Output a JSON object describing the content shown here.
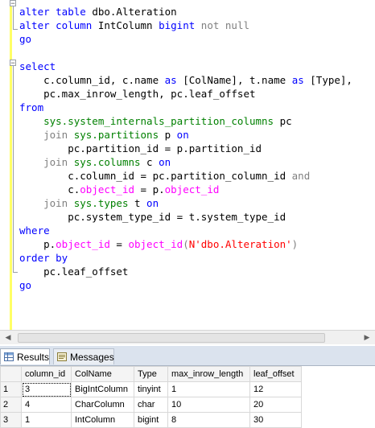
{
  "editor": {
    "lines": [
      [
        {
          "t": "alter table",
          "c": "kw"
        },
        {
          "t": " dbo.Alteration",
          "c": "txt"
        }
      ],
      [
        {
          "t": "alter column",
          "c": "kw"
        },
        {
          "t": " IntColumn ",
          "c": "txt"
        },
        {
          "t": "bigint",
          "c": "kw"
        },
        {
          "t": " ",
          "c": "txt"
        },
        {
          "t": "not null",
          "c": "gray"
        }
      ],
      [
        {
          "t": "go",
          "c": "kw"
        }
      ],
      [],
      [
        {
          "t": "select",
          "c": "kw"
        }
      ],
      [
        {
          "t": "    c.column_id, c.name ",
          "c": "txt"
        },
        {
          "t": "as",
          "c": "kw"
        },
        {
          "t": " [ColName], t.name ",
          "c": "txt"
        },
        {
          "t": "as",
          "c": "kw"
        },
        {
          "t": " [Type],",
          "c": "txt"
        }
      ],
      [
        {
          "t": "    pc.max_inrow_length, pc.leaf_offset",
          "c": "txt"
        }
      ],
      [
        {
          "t": "from",
          "c": "kw"
        }
      ],
      [
        {
          "t": "    sys.system_internals_partition_columns",
          "c": "sys"
        },
        {
          "t": " pc",
          "c": "txt"
        }
      ],
      [
        {
          "t": "    join ",
          "c": "gray"
        },
        {
          "t": "sys.partitions",
          "c": "sys"
        },
        {
          "t": " p ",
          "c": "txt"
        },
        {
          "t": "on",
          "c": "kw"
        }
      ],
      [
        {
          "t": "        pc.partition_id = p.partition_id",
          "c": "txt"
        }
      ],
      [
        {
          "t": "    join ",
          "c": "gray"
        },
        {
          "t": "sys.columns",
          "c": "sys"
        },
        {
          "t": " c ",
          "c": "txt"
        },
        {
          "t": "on",
          "c": "kw"
        }
      ],
      [
        {
          "t": "        c.column_id = pc.partition_column_id ",
          "c": "txt"
        },
        {
          "t": "and",
          "c": "gray"
        }
      ],
      [
        {
          "t": "        c.",
          "c": "txt"
        },
        {
          "t": "object_id",
          "c": "fn"
        },
        {
          "t": " = p.",
          "c": "txt"
        },
        {
          "t": "object_id",
          "c": "fn"
        }
      ],
      [
        {
          "t": "    join ",
          "c": "gray"
        },
        {
          "t": "sys.types",
          "c": "sys"
        },
        {
          "t": " t ",
          "c": "txt"
        },
        {
          "t": "on",
          "c": "kw"
        }
      ],
      [
        {
          "t": "        pc.system_type_id = t.system_type_id",
          "c": "txt"
        }
      ],
      [
        {
          "t": "where",
          "c": "kw"
        }
      ],
      [
        {
          "t": "    p.",
          "c": "txt"
        },
        {
          "t": "object_id",
          "c": "fn"
        },
        {
          "t": " = ",
          "c": "txt"
        },
        {
          "t": "object_id",
          "c": "fn"
        },
        {
          "t": "(",
          "c": "gray"
        },
        {
          "t": "N'dbo.Alteration'",
          "c": "str"
        },
        {
          "t": ")",
          "c": "gray"
        }
      ],
      [
        {
          "t": "order by",
          "c": "kw"
        }
      ],
      [
        {
          "t": "    pc.leaf_offset",
          "c": "txt"
        }
      ],
      [
        {
          "t": "go",
          "c": "kw"
        }
      ]
    ]
  },
  "results_tabs": [
    {
      "label": "Results",
      "icon": "results-grid-icon",
      "active": true
    },
    {
      "label": "Messages",
      "icon": "messages-icon",
      "active": false
    }
  ],
  "grid": {
    "columns": [
      "column_id",
      "ColName",
      "Type",
      "max_inrow_length",
      "leaf_offset"
    ],
    "rows": [
      {
        "n": "1",
        "cells": [
          "3",
          "BigIntColumn",
          "tinyint",
          "1",
          "12"
        ]
      },
      {
        "n": "2",
        "cells": [
          "4",
          "CharColumn",
          "char",
          "10",
          "20"
        ]
      },
      {
        "n": "3",
        "cells": [
          "1",
          "IntColumn",
          "bigint",
          "8",
          "30"
        ]
      }
    ]
  },
  "colors": {
    "keyword": "#0000ff",
    "function": "#ff00ff",
    "system_object": "#008000",
    "operator": "#808080",
    "string": "#ff0000"
  }
}
